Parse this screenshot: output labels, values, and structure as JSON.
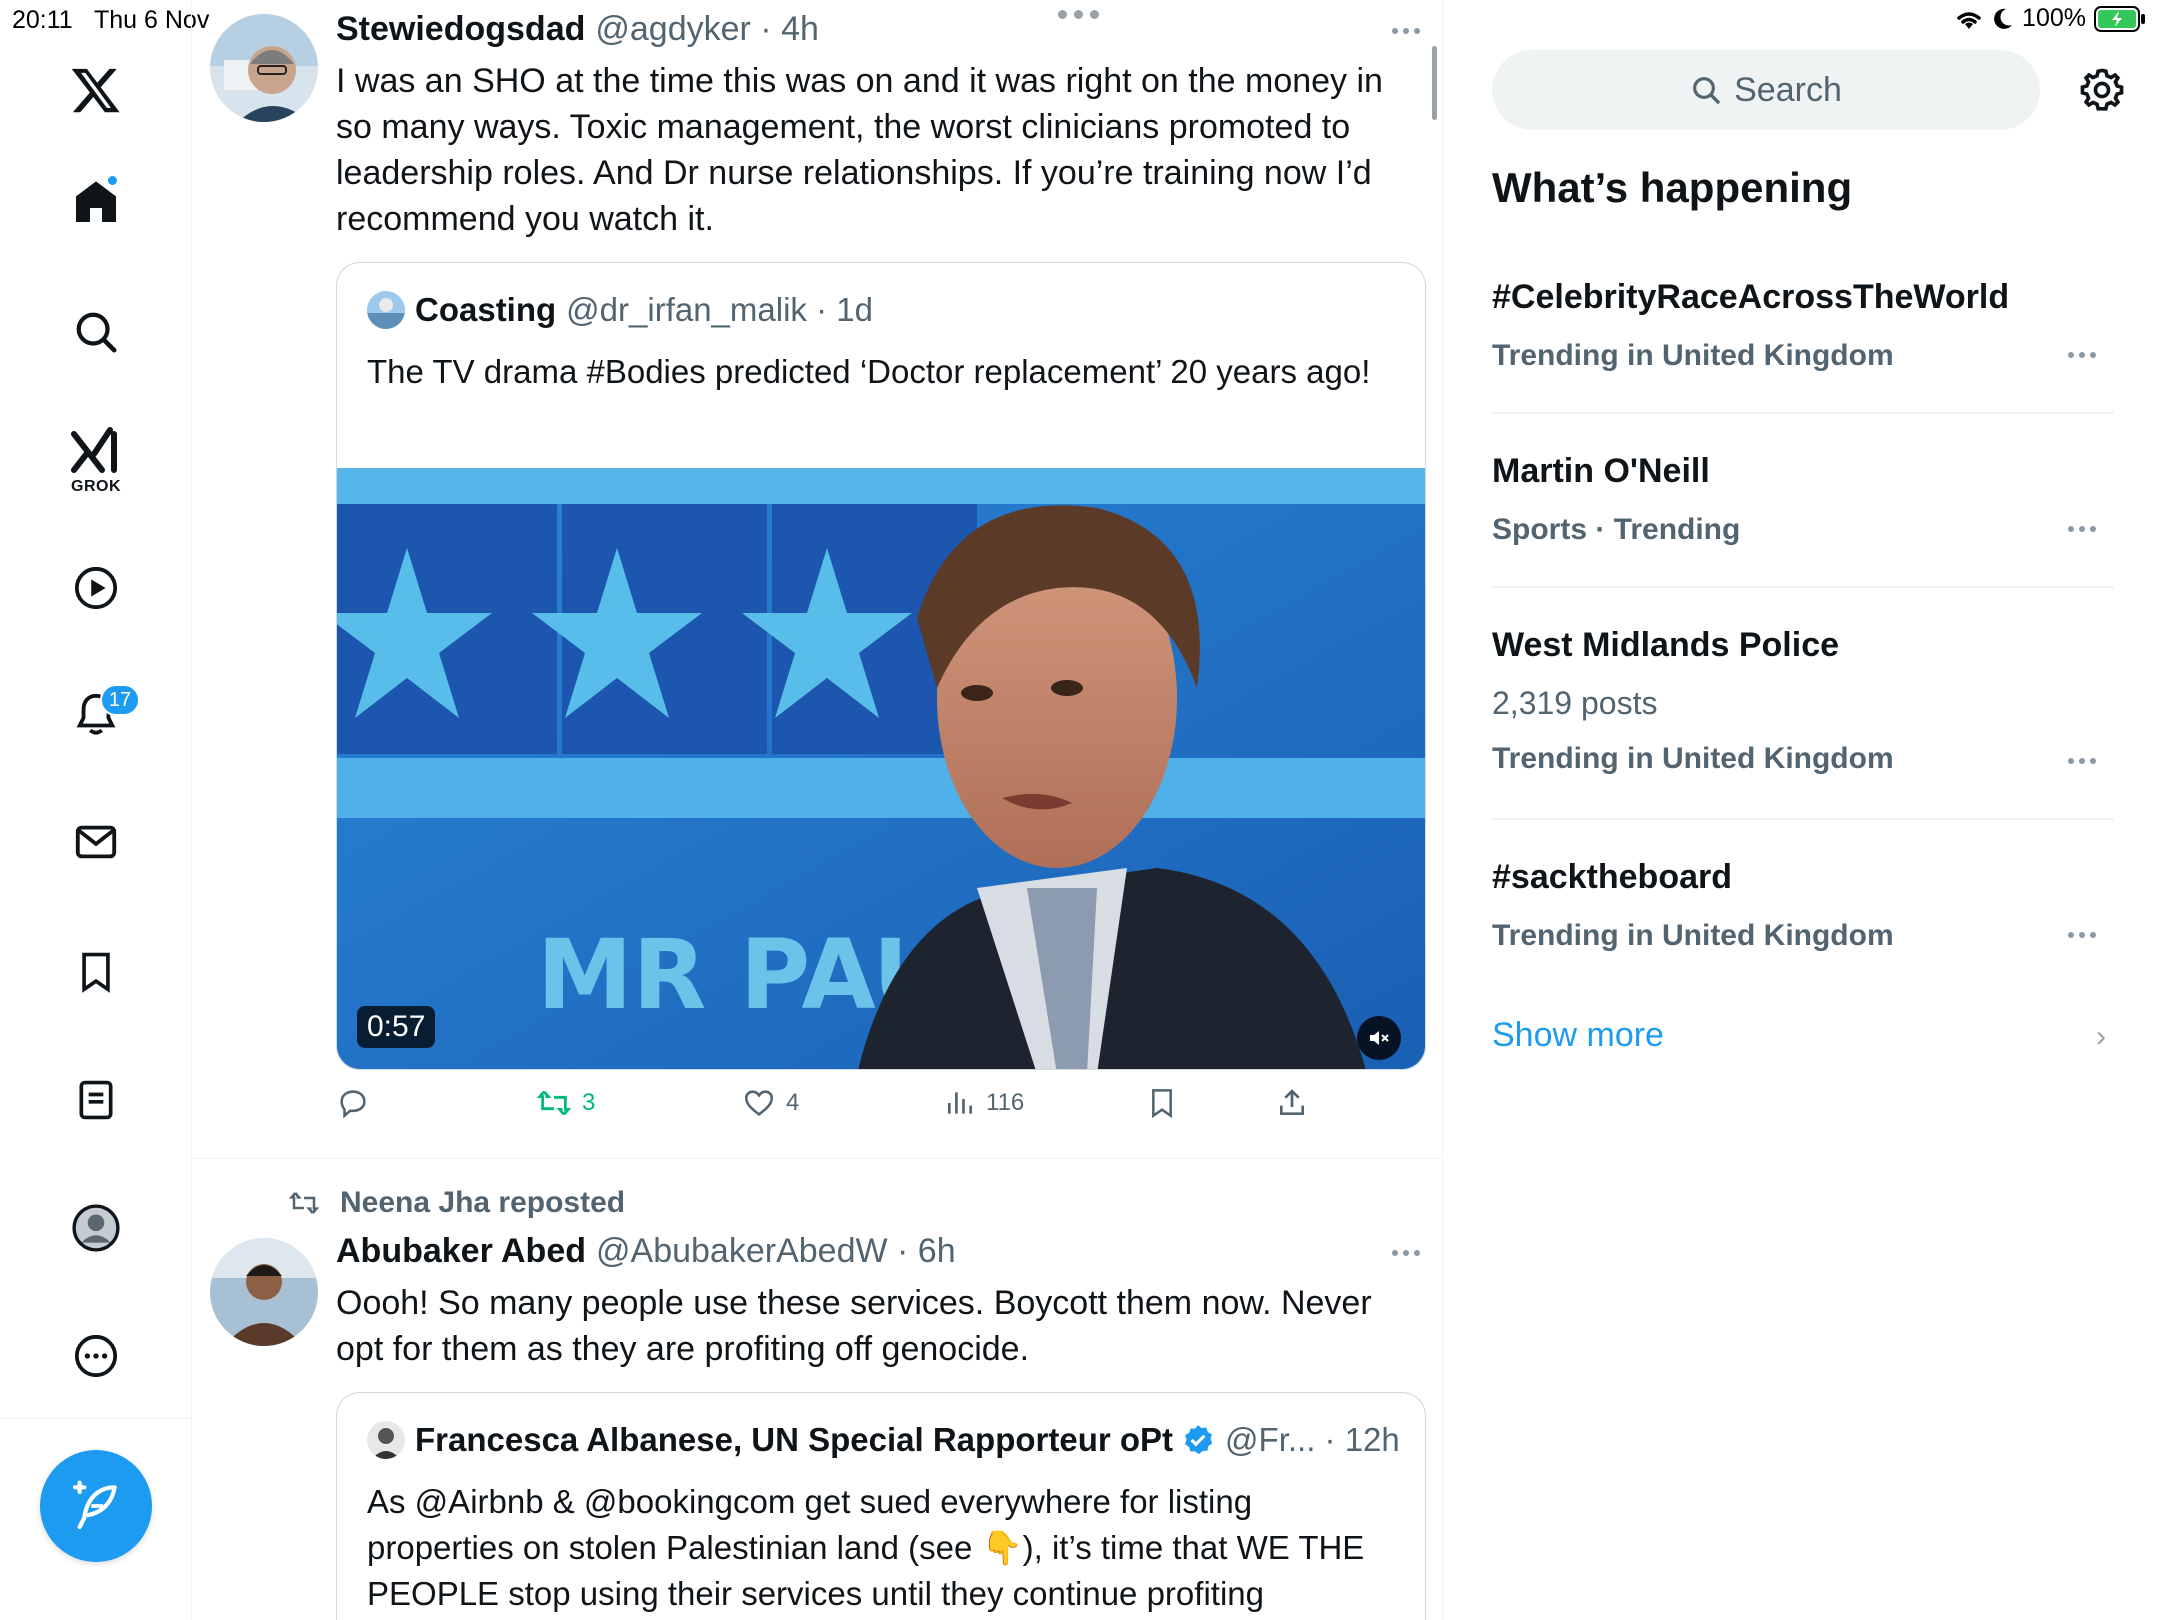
{
  "status_bar": {
    "time": "20:11",
    "date": "Thu 6 Nov",
    "battery": "100%"
  },
  "nav": {
    "grok_label": "GROK",
    "notifications_count": "17"
  },
  "tweet1": {
    "name": "Stewiedogsdad",
    "handle_time": "@agdyker · 4h",
    "text": "I was an SHO at the time this was on and it was right on the money in so many ways. Toxic management, the worst clinicians promoted to leadership roles. And Dr nurse relationships. If you’re  training now I’d recommend you watch it.",
    "quote": {
      "name": "Coasting",
      "handle_time": "@dr_irfan_malik · 1d",
      "text": "The TV drama #Bodies predicted ‘Doctor replacement’ 20 years ago!",
      "video_caption": "MR PAUL TR",
      "duration": "0:57"
    },
    "actions": {
      "retweets": "3",
      "likes": "4",
      "views": "116"
    }
  },
  "tweet2": {
    "repost_label": "Neena Jha reposted",
    "name": "Abubaker Abed",
    "handle_time": "@AbubakerAbedW · 6h",
    "text": "Oooh! So many people use these services. Boycott them now. Never opt for them as they are profiting off genocide.",
    "quote": {
      "name": "Francesca Albanese, UN Special Rapporteur oPt",
      "handle_time": "@Fr... · 12h",
      "text": "As @Airbnb & @bookingcom get sued everywhere for listing properties on stolen Palestinian land (see  👇), it’s time that WE THE PEOPLE stop using their services until they continue profiting"
    }
  },
  "sidebar": {
    "search_placeholder": "Search",
    "title": "What’s happening",
    "trends": [
      {
        "name": "#CelebrityRaceAcrossTheWorld",
        "sub": "Trending in United Kingdom"
      },
      {
        "name": "Martin O'Neill",
        "sub": "Sports · Trending"
      },
      {
        "name": "West Midlands Police",
        "posts": "2,319 posts",
        "sub": "Trending in United Kingdom"
      },
      {
        "name": "#sacktheboard",
        "sub": "Trending in United Kingdom"
      }
    ],
    "show_more": "Show more"
  },
  "colors": {
    "accent": "#1d9bf0",
    "retweet_green": "#00ba7c",
    "muted": "#536471"
  }
}
